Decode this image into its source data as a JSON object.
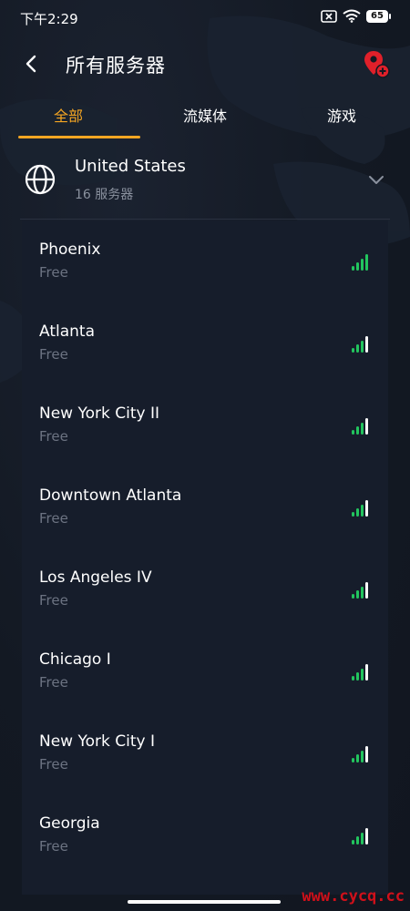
{
  "status_bar": {
    "time": "下午2:29",
    "battery": "65",
    "icons": [
      "sim-x-icon",
      "wifi-icon",
      "battery-icon"
    ]
  },
  "header": {
    "title": "所有服务器",
    "back_icon": "chevron-left-icon",
    "add_icon": "location-pin-plus-icon"
  },
  "tabs": [
    {
      "label": "全部",
      "active": true
    },
    {
      "label": "流媒体",
      "active": false
    },
    {
      "label": "游戏",
      "active": false
    }
  ],
  "country": {
    "name": "United States",
    "count": "16 服务器",
    "icon": "globe-icon",
    "expand_icon": "chevron-down-icon"
  },
  "servers": [
    {
      "name": "Phoenix",
      "tier": "Free"
    },
    {
      "name": "Atlanta",
      "tier": "Free"
    },
    {
      "name": "New York City II",
      "tier": "Free"
    },
    {
      "name": "Downtown Atlanta",
      "tier": "Free"
    },
    {
      "name": "Los Angeles IV",
      "tier": "Free"
    },
    {
      "name": "Chicago I",
      "tier": "Free"
    },
    {
      "name": "New York City I",
      "tier": "Free"
    },
    {
      "name": "Georgia",
      "tier": "Free"
    }
  ],
  "watermark": "www.cycq.cc",
  "colors": {
    "accent": "#f5a623",
    "signal": "#22c55e",
    "pin": "#e0202a",
    "background": "#131923"
  }
}
